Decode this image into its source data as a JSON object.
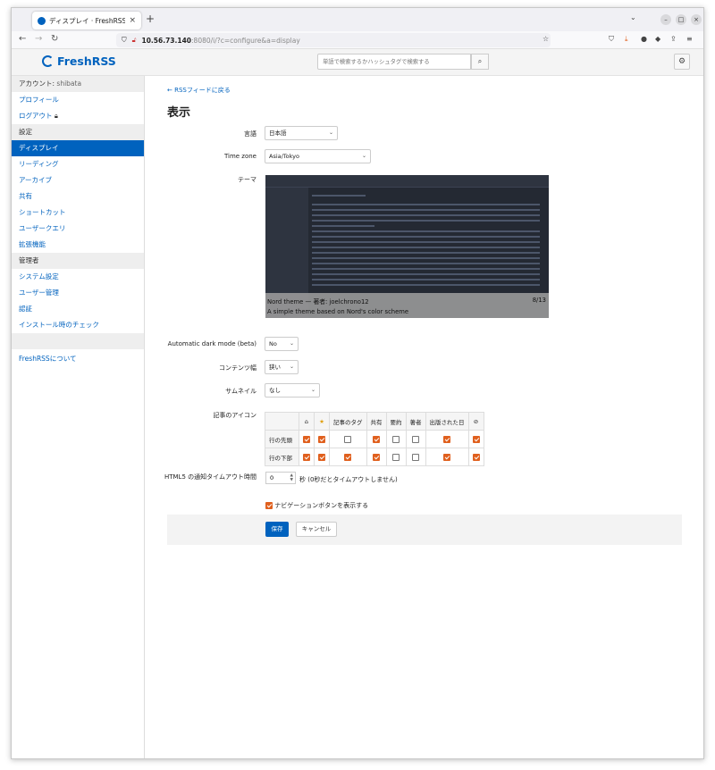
{
  "browser": {
    "tab_title": "ディスプレイ · FreshRSS",
    "url_host": "10.56.73.140",
    "url_rest": ":8080/i/?c=configure&a=display"
  },
  "header": {
    "logo": "FreshRSS",
    "search_placeholder": "単語で検索するかハッシュタグで検索する"
  },
  "sidebar": {
    "account_label": "アカウント:",
    "account_name": "shibata",
    "items_account": [
      "プロフィール",
      "ログアウト"
    ],
    "settings_label": "設定",
    "items_settings": [
      "ディスプレイ",
      "リーディング",
      "アーカイブ",
      "共有",
      "ショートカット",
      "ユーザークエリ",
      "拡張機能"
    ],
    "admin_label": "管理者",
    "items_admin": [
      "システム設定",
      "ユーザー管理",
      "認証",
      "インストール時のチェック"
    ],
    "about": "FreshRSSについて"
  },
  "main": {
    "back_link": "← RSSフィードに戻る",
    "title": "表示",
    "language_label": "言語",
    "language_value": "日本語",
    "timezone_label": "Time zone",
    "timezone_value": "Asia/Tokyo",
    "theme_label": "テーマ",
    "theme_caption": "Nord theme — 著者: joelchrono12",
    "theme_desc": "A simple theme based on Nord's color scheme",
    "theme_counter": "8/13",
    "darkmode_label": "Automatic dark mode (beta)",
    "darkmode_value": "No",
    "width_label": "コンテンツ幅",
    "width_value": "狭い",
    "thumb_label": "サムネイル",
    "thumb_value": "なし",
    "icons_label": "記事のアイコン",
    "icons_headers": [
      "",
      "",
      "★",
      "記事のタグ",
      "共有",
      "要約",
      "著者",
      "出版された日",
      ""
    ],
    "row_top_label": "行の先頭",
    "row_top": [
      true,
      true,
      false,
      true,
      false,
      false,
      true,
      true
    ],
    "row_bottom_label": "行の下部",
    "row_bottom": [
      true,
      true,
      true,
      true,
      false,
      false,
      true,
      true
    ],
    "html5_label": "HTML5 の通知タイムアウト時間",
    "html5_value": "0",
    "html5_suffix": "秒 (0秒だとタイムアウトしません)",
    "nav_buttons_label": "ナビゲーションボタンを表示する",
    "save": "保存",
    "cancel": "キャンセル"
  },
  "colors": {
    "accent": "#0062be",
    "checkbox": "#e0601e",
    "theme_bg": "#242933"
  }
}
